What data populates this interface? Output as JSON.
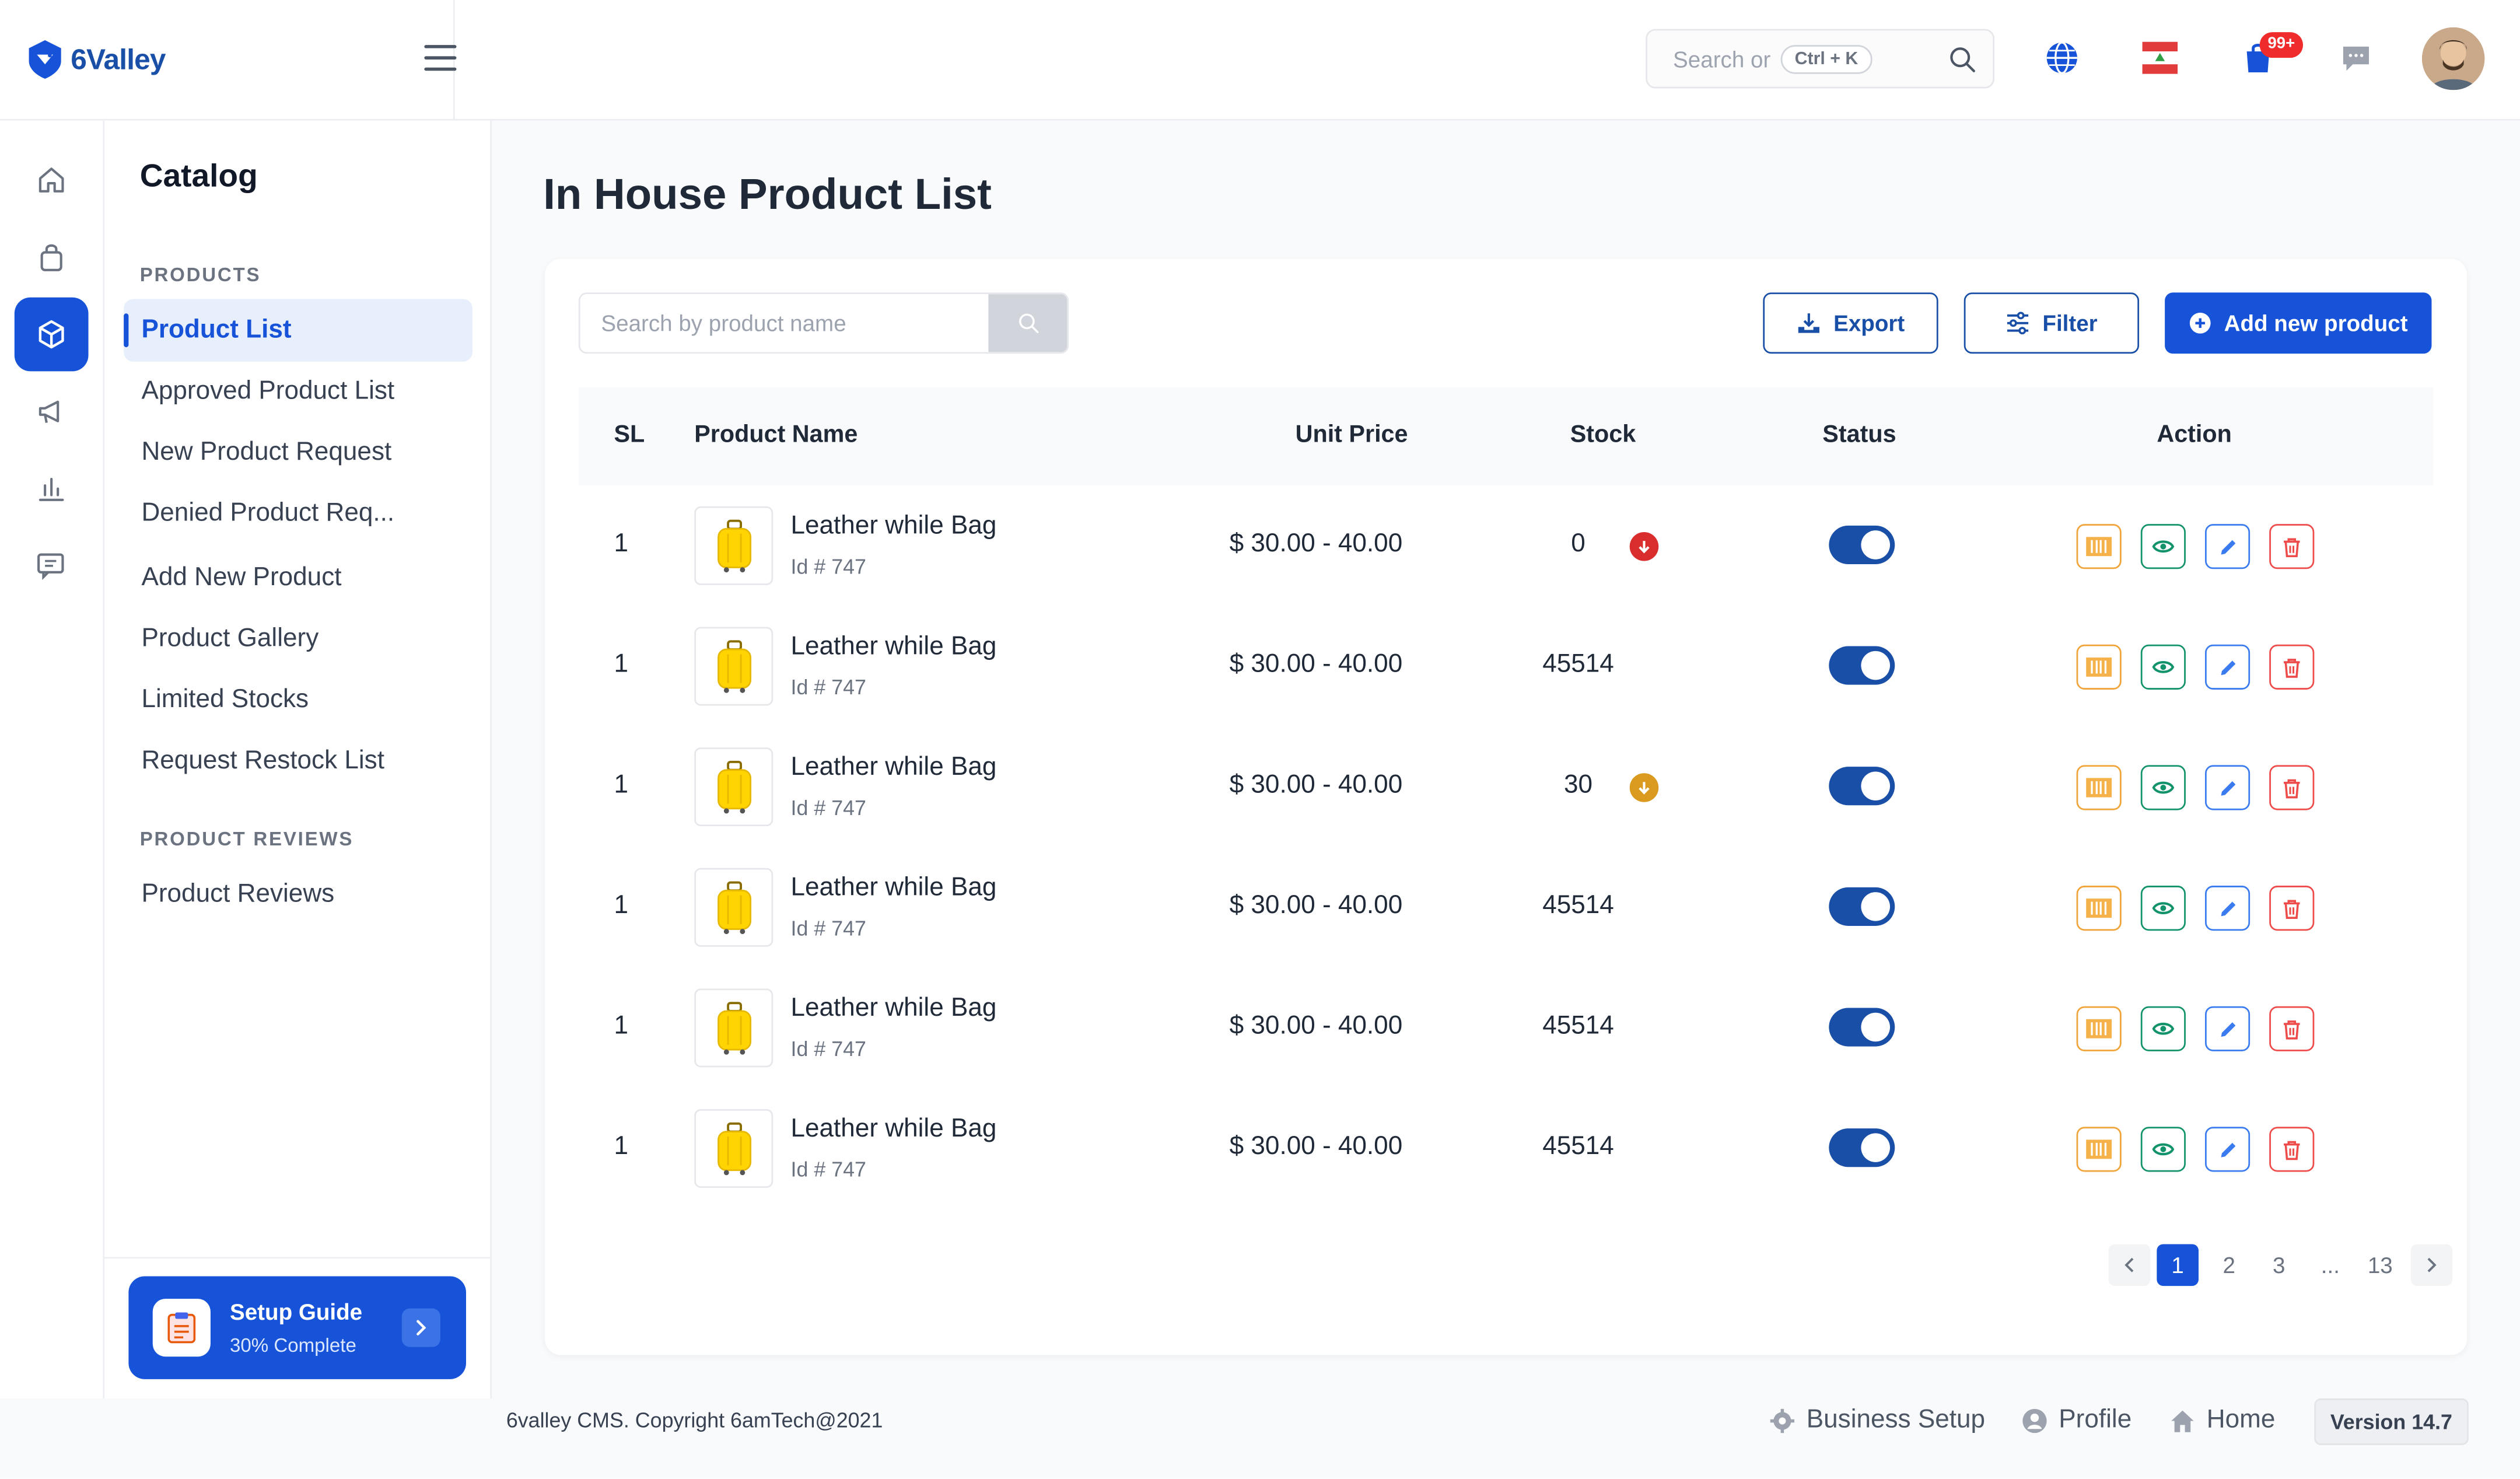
{
  "app": {
    "logo_text": "6Valley",
    "brand_color": "#1653d8"
  },
  "header": {
    "search_placeholder": "Search or",
    "search_shortcut": "Ctrl + K",
    "notification_count": "99+"
  },
  "rail": {
    "icons": [
      "home-icon",
      "bag-icon",
      "box-icon",
      "megaphone-icon",
      "bar-chart-icon",
      "chat-icon"
    ],
    "active_index": 2
  },
  "sidebar": {
    "title": "Catalog",
    "section_products": "PRODUCTS",
    "items": [
      {
        "label": "Product List",
        "active": true
      },
      {
        "label": "Approved Product List"
      },
      {
        "label": "New Product Request"
      },
      {
        "label": "Denied Product Req..."
      },
      {
        "label": "Add New Product"
      },
      {
        "label": "Product Gallery"
      },
      {
        "label": "Limited Stocks"
      },
      {
        "label": "Request Restock List"
      }
    ],
    "section_reviews": "PRODUCT REVIEWS",
    "review_items": [
      {
        "label": "Product Reviews"
      }
    ],
    "setup_guide": {
      "title": "Setup Guide",
      "subtitle": "30% Complete"
    }
  },
  "main": {
    "page_title": "In House Product List",
    "search_placeholder": "Search by product name",
    "export_label": "Export",
    "filter_label": "Filter",
    "add_label": "Add new product",
    "columns": {
      "sl": "SL",
      "name": "Product Name",
      "price": "Unit Price",
      "stock": "Stock",
      "status": "Status",
      "action": "Action"
    },
    "rows": [
      {
        "sl": "1",
        "name": "Leather while Bag",
        "id": "Id # 747",
        "price": "$ 30.00 - 40.00",
        "stock": "0",
        "stock_level": "out",
        "status": true
      },
      {
        "sl": "1",
        "name": "Leather while Bag",
        "id": "Id # 747",
        "price": "$ 30.00 - 40.00",
        "stock": "45514",
        "stock_level": "ok",
        "status": true
      },
      {
        "sl": "1",
        "name": "Leather while Bag",
        "id": "Id # 747",
        "price": "$ 30.00 - 40.00",
        "stock": "30",
        "stock_level": "low",
        "status": true
      },
      {
        "sl": "1",
        "name": "Leather while Bag",
        "id": "Id # 747",
        "price": "$ 30.00 - 40.00",
        "stock": "45514",
        "stock_level": "ok",
        "status": true
      },
      {
        "sl": "1",
        "name": "Leather while Bag",
        "id": "Id # 747",
        "price": "$ 30.00 - 40.00",
        "stock": "45514",
        "stock_level": "ok",
        "status": true
      },
      {
        "sl": "1",
        "name": "Leather while Bag",
        "id": "Id # 747",
        "price": "$ 30.00 - 40.00",
        "stock": "45514",
        "stock_level": "ok",
        "status": true
      }
    ],
    "pagination": {
      "pages": [
        "1",
        "2",
        "3",
        "...",
        "13"
      ],
      "current": "1"
    }
  },
  "footer": {
    "copyright": "6valley CMS. Copyright 6amTech@2021",
    "business_setup": "Business Setup",
    "profile": "Profile",
    "home": "Home",
    "version": "Version 14.7"
  }
}
